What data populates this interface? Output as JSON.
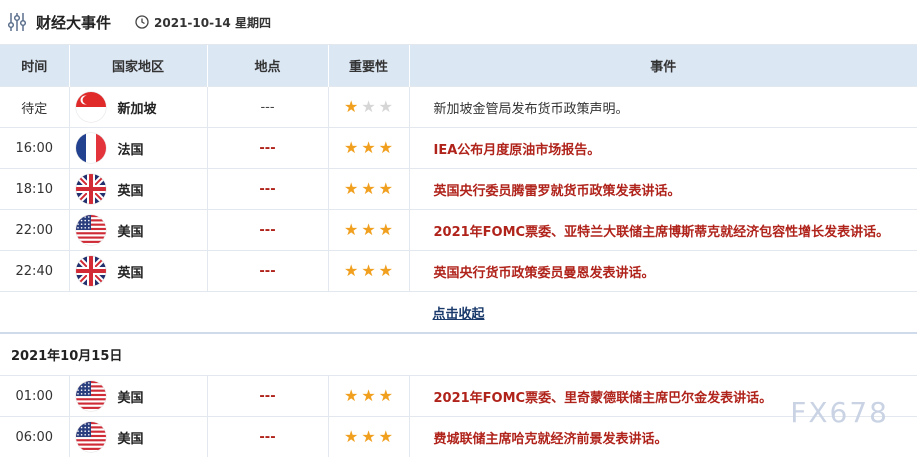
{
  "header": {
    "title": "财经大事件",
    "date": "2021-10-14 星期四"
  },
  "columns": {
    "time": "时间",
    "country": "国家地区",
    "location": "地点",
    "importance": "重要性",
    "event": "事件"
  },
  "rows": [
    {
      "time": "待定",
      "flag": "singapore-flag",
      "country": "新加坡",
      "location": "---",
      "stars": 1,
      "event": "新加坡金管局发布货币政策声明。",
      "highlight": false
    },
    {
      "time": "16:00",
      "flag": "france-flag",
      "country": "法国",
      "location": "---",
      "stars": 3,
      "event": "IEA公布月度原油市场报告。",
      "highlight": true
    },
    {
      "time": "18:10",
      "flag": "uk-flag",
      "country": "英国",
      "location": "---",
      "stars": 3,
      "event": "英国央行委员腾雷罗就货币政策发表讲话。",
      "highlight": true
    },
    {
      "time": "22:00",
      "flag": "us-flag",
      "country": "美国",
      "location": "---",
      "stars": 3,
      "event": "2021年FOMC票委、亚特兰大联储主席博斯蒂克就经济包容性增长发表讲话。",
      "highlight": true
    },
    {
      "time": "22:40",
      "flag": "uk-flag",
      "country": "英国",
      "location": "---",
      "stars": 3,
      "event": "英国央行货币政策委员曼恩发表讲话。",
      "highlight": true
    }
  ],
  "collapse_label": "点击收起",
  "next_date": "2021年10月15日",
  "rows2": [
    {
      "time": "01:00",
      "flag": "us-flag",
      "country": "美国",
      "location": "---",
      "stars": 3,
      "event": "2021年FOMC票委、里奇蒙德联储主席巴尔金发表讲话。",
      "highlight": true
    },
    {
      "time": "06:00",
      "flag": "us-flag",
      "country": "美国",
      "location": "---",
      "stars": 3,
      "event": "费城联储主席哈克就经济前景发表讲话。",
      "highlight": true
    }
  ],
  "watermark": "FX678",
  "colors": {
    "header_bg": "#dce7f4",
    "event_red": "#b0231b",
    "star_on": "#f0a01e",
    "star_off": "#d6d6d6"
  }
}
